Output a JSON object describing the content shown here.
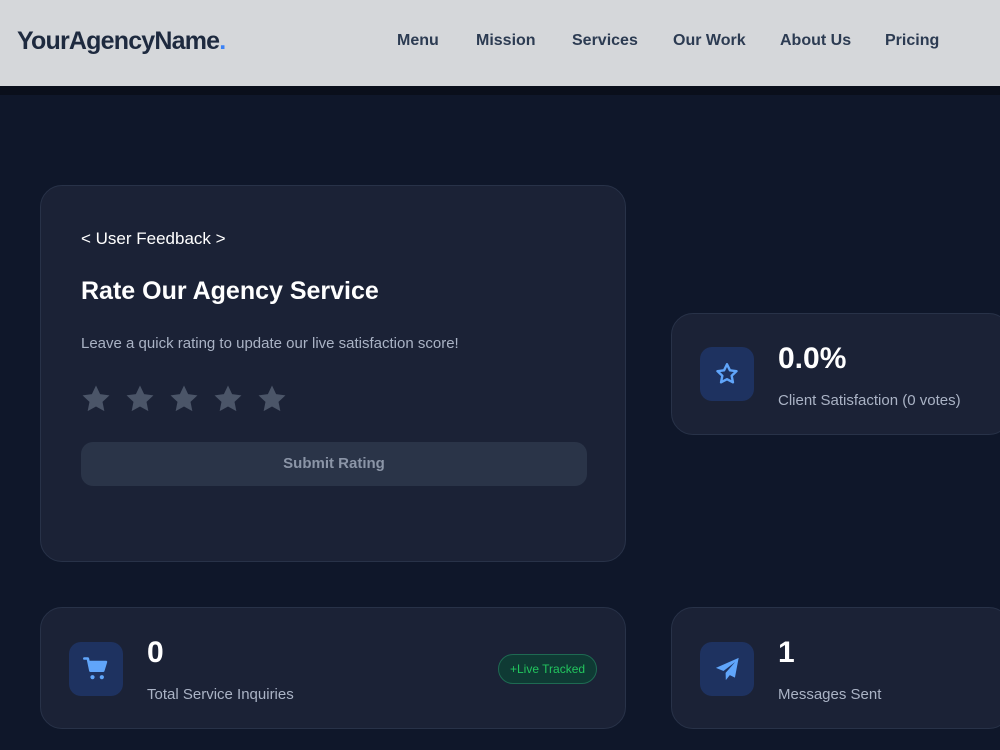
{
  "header": {
    "logo_text": "YourAgencyName",
    "logo_dot": ".",
    "nav": [
      "Menu",
      "Mission",
      "Services",
      "Our Work",
      "About Us",
      "Pricing"
    ]
  },
  "feedback": {
    "tag": "< User Feedback >",
    "title": "Rate Our Agency Service",
    "subtitle": "Leave a quick rating to update our live satisfaction score!",
    "star_count": 5,
    "selected_rating": 0,
    "submit_label": "Submit Rating"
  },
  "stats": {
    "satisfaction": {
      "value": "0.0%",
      "label": "Client Satisfaction (0 votes)",
      "icon": "star-icon"
    },
    "inquiries": {
      "value": "0",
      "label": "Total Service Inquiries",
      "badge": "+Live Tracked",
      "icon": "cart-icon"
    },
    "messages": {
      "value": "1",
      "label": "Messages Sent",
      "icon": "paper-plane-icon"
    }
  },
  "colors": {
    "background": "#0f172a",
    "card": "#1b2236",
    "accent": "#3b82f6",
    "badge_green": "#22c55e",
    "navbar": "#d5d7da"
  }
}
